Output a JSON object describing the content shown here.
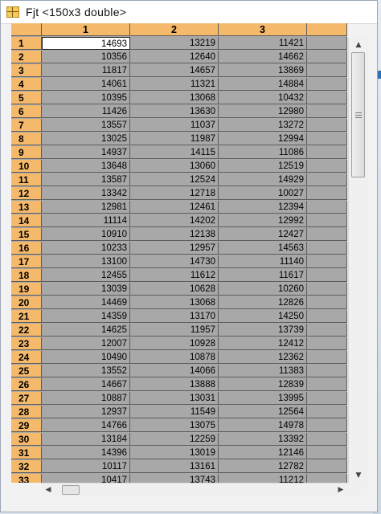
{
  "window": {
    "title": "Fjt <150x3 double>",
    "icon": "variable-table-icon"
  },
  "table": {
    "column_headers": [
      "1",
      "2",
      "3"
    ],
    "selected_cell": {
      "row": 1,
      "col": 1
    },
    "rows": [
      {
        "label": "1",
        "values": [
          "14693",
          "13219",
          "11421"
        ]
      },
      {
        "label": "2",
        "values": [
          "10356",
          "12640",
          "14662"
        ]
      },
      {
        "label": "3",
        "values": [
          "11817",
          "14657",
          "13869"
        ]
      },
      {
        "label": "4",
        "values": [
          "14061",
          "11321",
          "14884"
        ]
      },
      {
        "label": "5",
        "values": [
          "10395",
          "13068",
          "10432"
        ]
      },
      {
        "label": "6",
        "values": [
          "11426",
          "13630",
          "12980"
        ]
      },
      {
        "label": "7",
        "values": [
          "13557",
          "11037",
          "13272"
        ]
      },
      {
        "label": "8",
        "values": [
          "13025",
          "11987",
          "12994"
        ]
      },
      {
        "label": "9",
        "values": [
          "14937",
          "14115",
          "11086"
        ]
      },
      {
        "label": "10",
        "values": [
          "13648",
          "13060",
          "12519"
        ]
      },
      {
        "label": "11",
        "values": [
          "13587",
          "12524",
          "14929"
        ]
      },
      {
        "label": "12",
        "values": [
          "13342",
          "12718",
          "10027"
        ]
      },
      {
        "label": "13",
        "values": [
          "12981",
          "12461",
          "12394"
        ]
      },
      {
        "label": "14",
        "values": [
          "11114",
          "14202",
          "12992"
        ]
      },
      {
        "label": "15",
        "values": [
          "10910",
          "12138",
          "12427"
        ]
      },
      {
        "label": "16",
        "values": [
          "10233",
          "12957",
          "14563"
        ]
      },
      {
        "label": "17",
        "values": [
          "13100",
          "14730",
          "11140"
        ]
      },
      {
        "label": "18",
        "values": [
          "12455",
          "11612",
          "11617"
        ]
      },
      {
        "label": "19",
        "values": [
          "13039",
          "10628",
          "10260"
        ]
      },
      {
        "label": "20",
        "values": [
          "14469",
          "13068",
          "12826"
        ]
      },
      {
        "label": "21",
        "values": [
          "14359",
          "13170",
          "14250"
        ]
      },
      {
        "label": "22",
        "values": [
          "14625",
          "11957",
          "13739"
        ]
      },
      {
        "label": "23",
        "values": [
          "12007",
          "10928",
          "12412"
        ]
      },
      {
        "label": "24",
        "values": [
          "10490",
          "10878",
          "12362"
        ]
      },
      {
        "label": "25",
        "values": [
          "13552",
          "14066",
          "11383"
        ]
      },
      {
        "label": "26",
        "values": [
          "14667",
          "13888",
          "12839"
        ]
      },
      {
        "label": "27",
        "values": [
          "10887",
          "13031",
          "13995"
        ]
      },
      {
        "label": "28",
        "values": [
          "12937",
          "11549",
          "12564"
        ]
      },
      {
        "label": "29",
        "values": [
          "14766",
          "13075",
          "14978"
        ]
      },
      {
        "label": "30",
        "values": [
          "13184",
          "12259",
          "13392"
        ]
      },
      {
        "label": "31",
        "values": [
          "14396",
          "13019",
          "12146"
        ]
      },
      {
        "label": "32",
        "values": [
          "10117",
          "13161",
          "12782"
        ]
      },
      {
        "label": "33",
        "values": [
          "10417",
          "13743",
          "11212"
        ]
      }
    ]
  },
  "scrollbars": {
    "up_icon": "▲",
    "down_icon": "▼",
    "left_icon": "◀",
    "right_icon": "▶"
  },
  "colors": {
    "header_bg": "#f5b96b",
    "cell_bg": "#a8a8a8",
    "selected_bg": "#ffffff"
  }
}
